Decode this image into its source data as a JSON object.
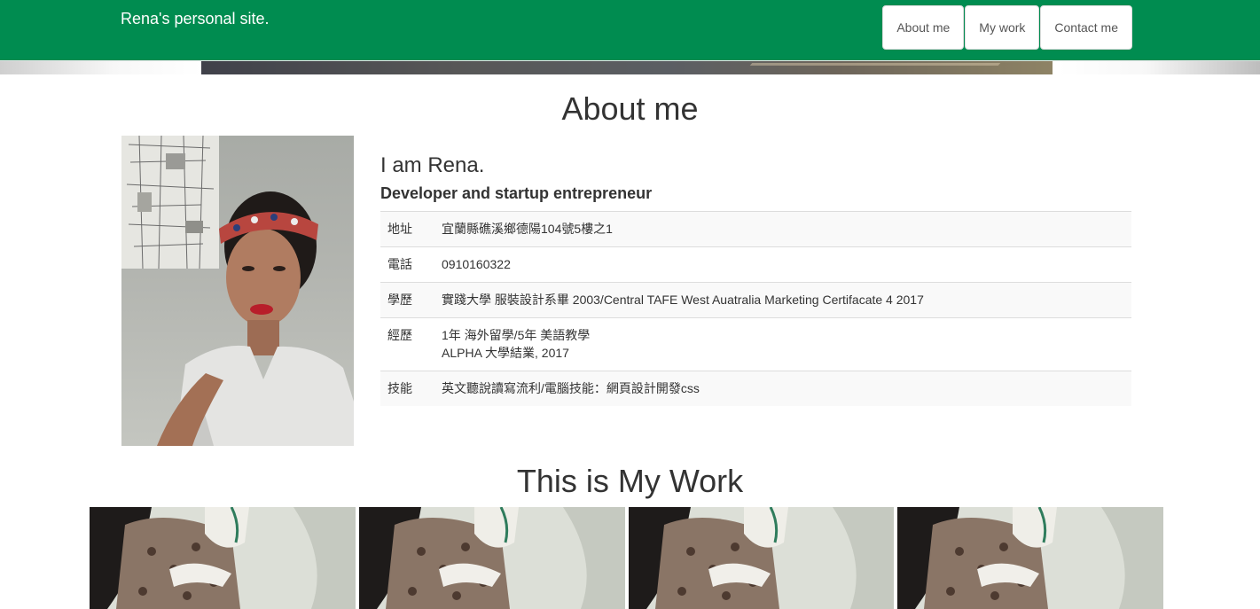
{
  "navbar": {
    "brand": "Rena's personal site.",
    "links": [
      {
        "label": "About me"
      },
      {
        "label": "My work"
      },
      {
        "label": "Contact me"
      }
    ],
    "background_color": "#008c50"
  },
  "about": {
    "title": "About me",
    "name": "I am Rena.",
    "role": "Developer and startup entrepreneur",
    "info_rows": [
      {
        "label": "地址",
        "lines": [
          "宜蘭縣礁溪鄉德陽104號5樓之1"
        ]
      },
      {
        "label": "電話",
        "lines": [
          "0910160322"
        ]
      },
      {
        "label": "學歷",
        "lines": [
          "實踐大學 服裝設計系畢 2003/Central TAFE West Auatralia Marketing Certifacate 4 2017"
        ]
      },
      {
        "label": "經歷",
        "lines": [
          "1年 海外留學/5年 美語教學",
          "ALPHA 大學結業, 2017"
        ]
      },
      {
        "label": "技能",
        "lines": [
          "英文聽說讀寫流利/電腦技能：網頁設計開發css"
        ]
      }
    ]
  },
  "work": {
    "title": "This is My Work",
    "tile_count": 4
  }
}
